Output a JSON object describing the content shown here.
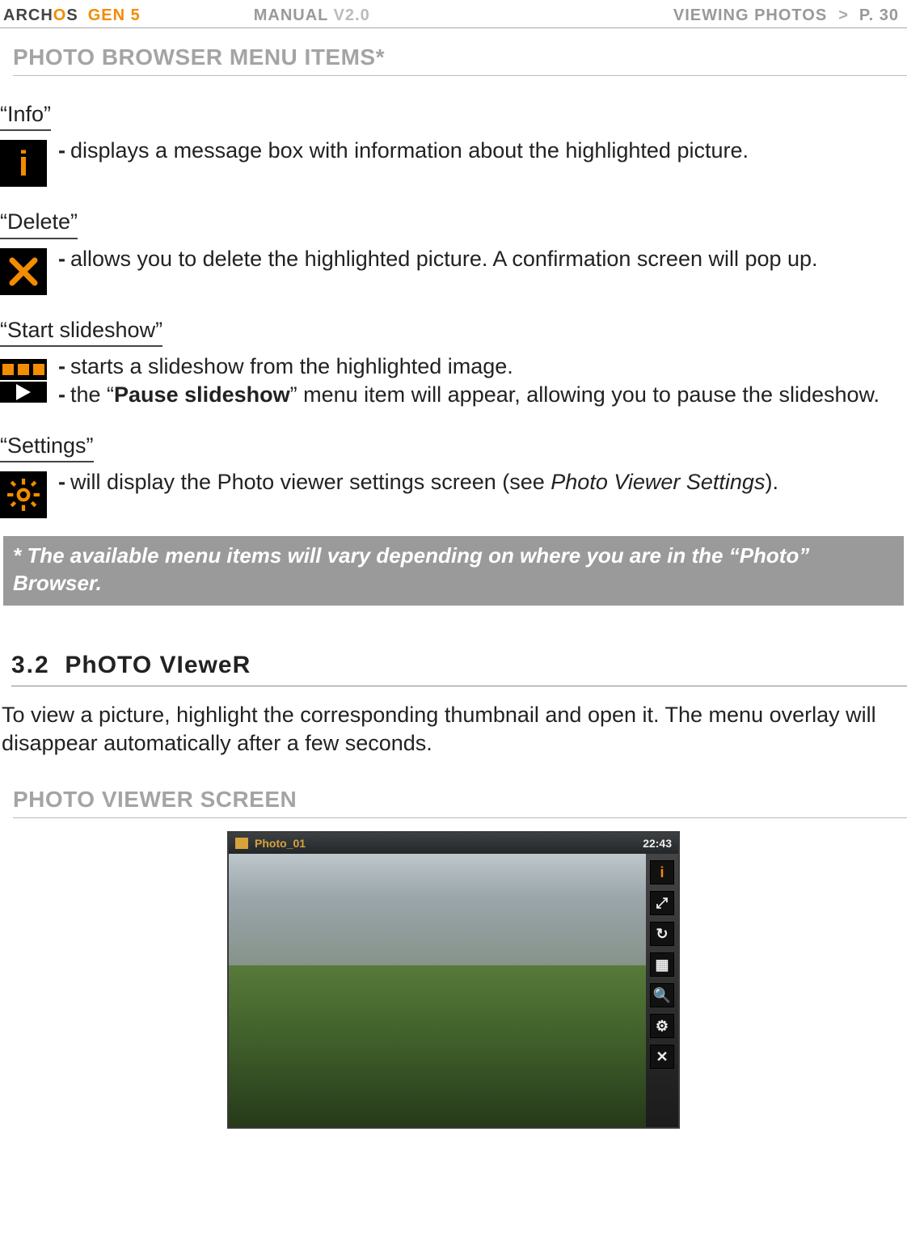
{
  "header": {
    "brand_prefix": "ARCH",
    "brand_o": "O",
    "brand_suffix": "S",
    "gen": "GEN 5",
    "manual": "MANUAL",
    "version": "V2.0",
    "breadcrumb": "VIEWING PHOTOS",
    "chevron": ">",
    "page": "P. 30"
  },
  "section1_title": "PHOTO BROWSER MENU ITEMS*",
  "items": {
    "info": {
      "title": "“Info”",
      "line1": "displays a message box with information about the highlighted picture."
    },
    "delete": {
      "title": "“Delete”",
      "line1": "allows you to delete the highlighted picture. A confirmation screen will pop up."
    },
    "slideshow": {
      "title": "“Start slideshow”",
      "line1": "starts a slideshow from the highlighted image.",
      "line2_pre": "the “",
      "line2_bold": "Pause slideshow",
      "line2_post": "” menu item will appear, allowing you to pause the slideshow."
    },
    "settings": {
      "title": "“Settings”",
      "line1_pre": "will display the Photo viewer settings screen (see ",
      "line1_italic": "Photo Viewer Settings",
      "line1_post": ")."
    }
  },
  "note": "* The available menu items will vary depending on where you are in the “Photo” Browser.",
  "section2": {
    "number": "3.2",
    "title": "PhOTO VIeweR",
    "paragraph": "To view a picture, highlight the corresponding thumbnail and open it. The menu overlay will disappear automatically after a few seconds."
  },
  "section3_title": "PHOTO VIEWER SCREEN",
  "device": {
    "title": "Photo_01",
    "clock": "22:43"
  }
}
